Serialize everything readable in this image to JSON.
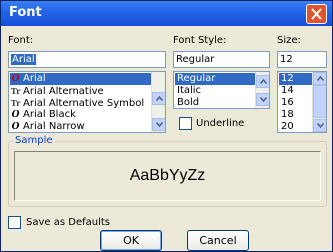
{
  "window": {
    "title": "Font"
  },
  "font": {
    "label": "Font:",
    "value": "Arial",
    "items": [
      {
        "name": "Arial",
        "icon": "o-red-icon",
        "selected": true
      },
      {
        "name": "Arial Alternative",
        "icon": "truetype-icon",
        "selected": false
      },
      {
        "name": "Arial Alternative Symbol",
        "icon": "truetype-icon",
        "selected": false
      },
      {
        "name": "Arial Black",
        "icon": "opentype-icon",
        "selected": false
      },
      {
        "name": "Arial Narrow",
        "icon": "opentype-icon",
        "selected": false
      }
    ]
  },
  "style": {
    "label": "Font Style:",
    "value": "Regular",
    "items": [
      "Regular",
      "Italic",
      "Bold"
    ],
    "selected_index": 0
  },
  "size": {
    "label": "Size:",
    "value": "12",
    "items": [
      "12",
      "14",
      "16",
      "18",
      "20"
    ],
    "selected_index": 0
  },
  "underline": {
    "label": "Underline",
    "checked": false
  },
  "sample": {
    "title": "Sample",
    "text": "AaBbYyZz"
  },
  "save_defaults": {
    "label": "Save as Defaults",
    "checked": false
  },
  "buttons": {
    "ok": "OK",
    "cancel": "Cancel"
  },
  "colors": {
    "title_bar": "#2263E6",
    "selection": "#316AC5",
    "close": "#E0552E",
    "dialog_bg": "#ECE9D8"
  }
}
